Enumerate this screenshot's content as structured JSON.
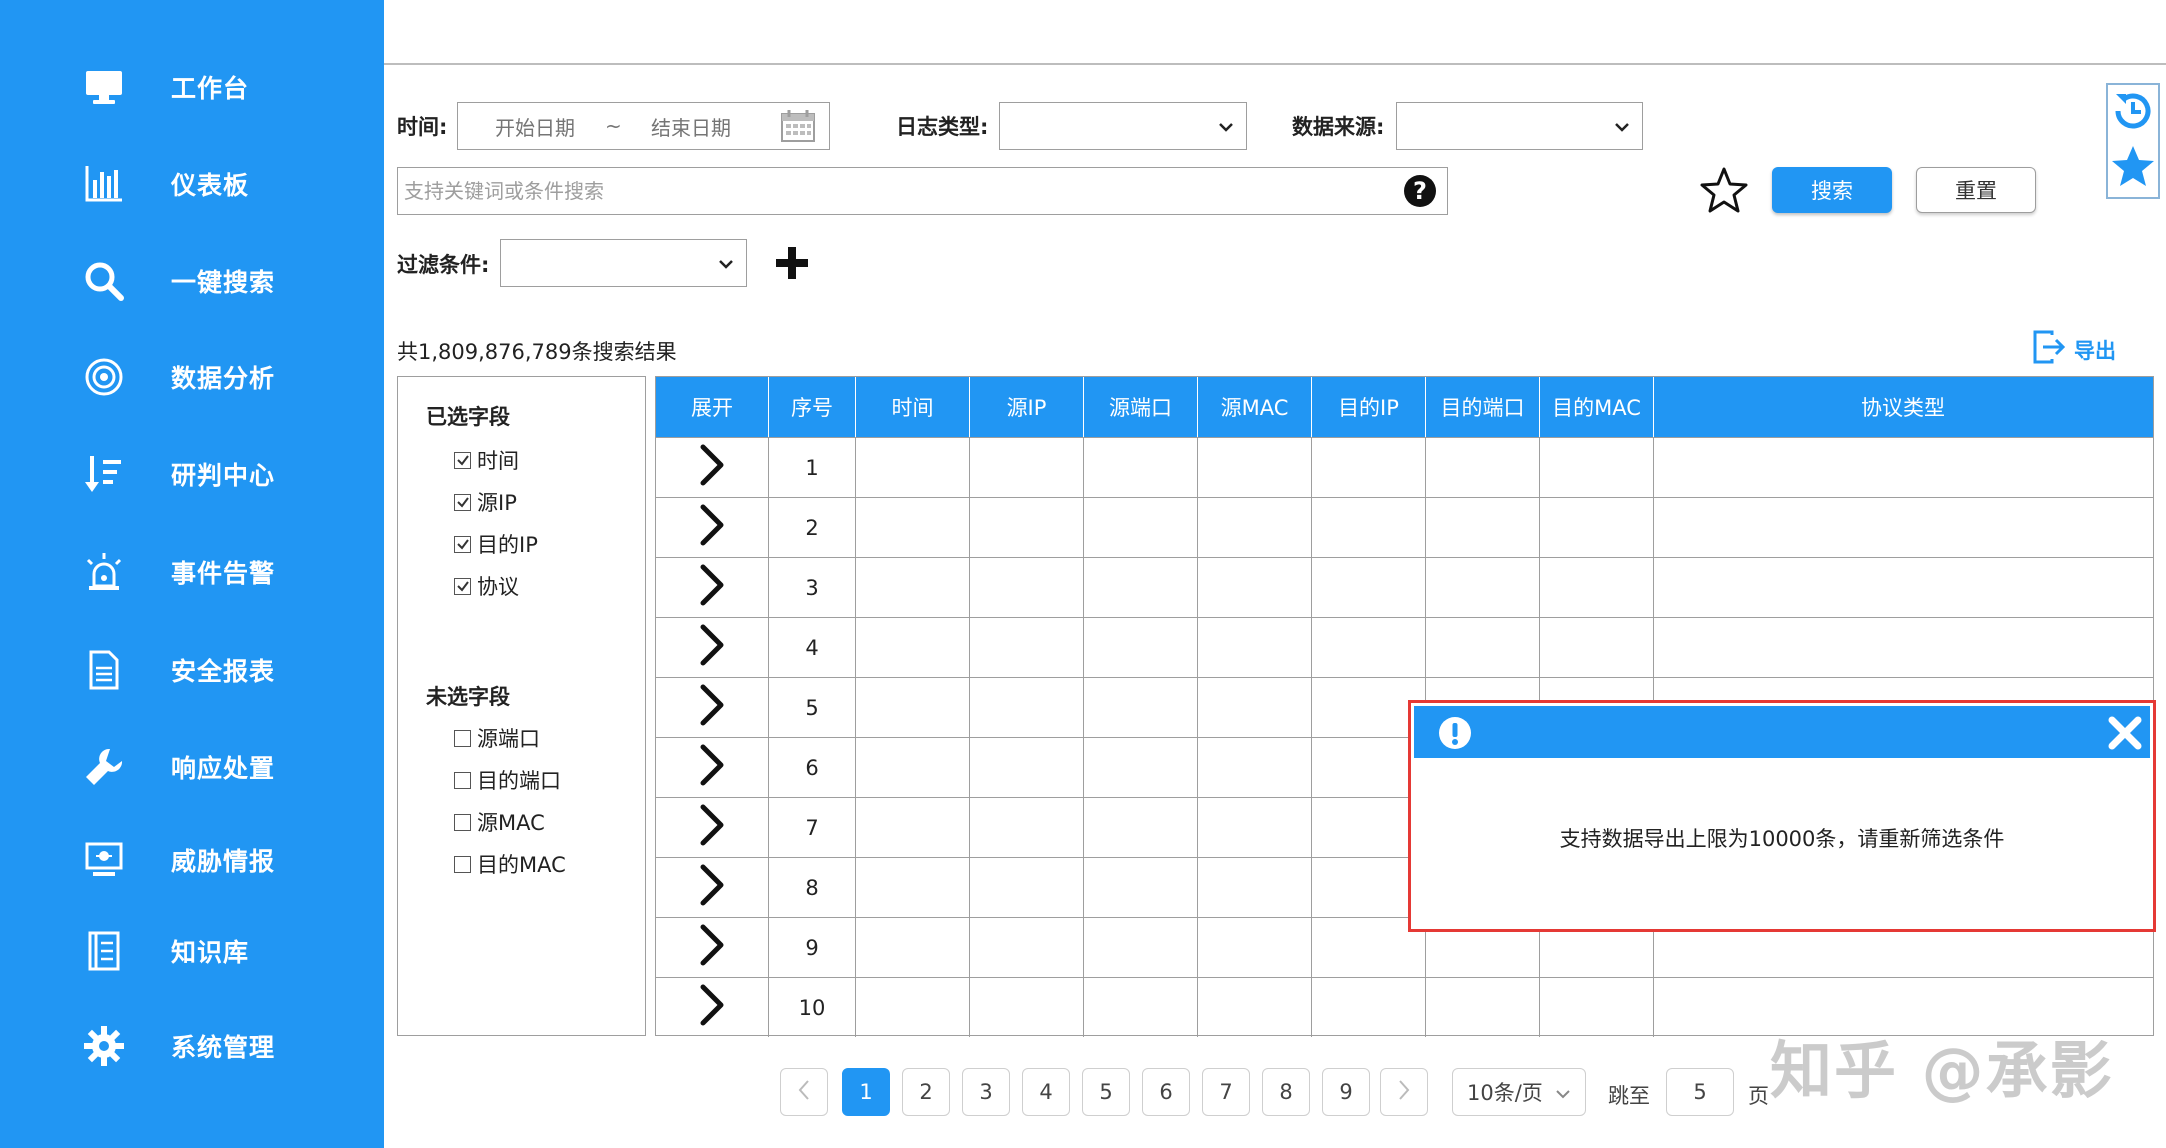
{
  "sidebar": {
    "items": [
      {
        "label": "工作台",
        "icon": "monitor-icon"
      },
      {
        "label": "仪表板",
        "icon": "bar-chart-icon"
      },
      {
        "label": "一键搜索",
        "icon": "search-icon"
      },
      {
        "label": "数据分析",
        "icon": "target-icon"
      },
      {
        "label": "研判中心",
        "icon": "sort-icon"
      },
      {
        "label": "事件告警",
        "icon": "alarm-icon"
      },
      {
        "label": "安全报表",
        "icon": "document-icon"
      },
      {
        "label": "响应处置",
        "icon": "wrench-icon"
      },
      {
        "label": "威胁情报",
        "icon": "screen-icon"
      },
      {
        "label": "知识库",
        "icon": "book-icon"
      },
      {
        "label": "系统管理",
        "icon": "gear-icon"
      }
    ]
  },
  "form": {
    "time_label": "时间:",
    "start_placeholder": "开始日期",
    "tilde": "~",
    "end_placeholder": "结束日期",
    "log_type_label": "日志类型:",
    "log_type_value": "",
    "source_label": "数据来源:",
    "source_value": "",
    "search_placeholder": "支持关键词或条件搜索",
    "filter_label": "过滤条件:",
    "filter_value": "",
    "search_button": "搜索",
    "reset_button": "重置"
  },
  "results": {
    "count_text": "共1,809,876,789条搜索结果",
    "export_label": "导出"
  },
  "field_panel": {
    "selected_title": "已选字段",
    "selected": [
      "时间",
      "源IP",
      "目的IP",
      "协议"
    ],
    "unselected_title": "未选字段",
    "unselected": [
      "源端口",
      "目的端口",
      "源MAC",
      "目的MAC"
    ]
  },
  "table": {
    "columns": [
      "展开",
      "序号",
      "时间",
      "源IP",
      "源端口",
      "源MAC",
      "目的IP",
      "目的端口",
      "目的MAC",
      "协议类型"
    ],
    "rows": [
      "1",
      "2",
      "3",
      "4",
      "5",
      "6",
      "7",
      "8",
      "9",
      "10"
    ]
  },
  "pagination": {
    "prev": "<",
    "pages": [
      "1",
      "2",
      "3",
      "4",
      "5",
      "6",
      "7",
      "8",
      "9"
    ],
    "active_page": "1",
    "next": ">",
    "page_size": "10条/页",
    "jump_label": "跳至",
    "jump_value": "5",
    "page_unit": "页"
  },
  "dialog": {
    "message": "支持数据导出上限为10000条，请重新筛选条件"
  },
  "watermark": "知乎 @承影",
  "colors": {
    "primary": "#2196f3",
    "alert_border": "#e53935"
  }
}
